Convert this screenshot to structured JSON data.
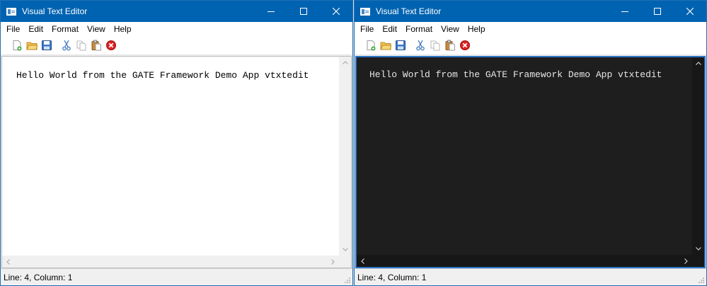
{
  "windows": [
    {
      "title": "Visual Text Editor",
      "theme": "light",
      "menu": [
        "File",
        "Edit",
        "Format",
        "View",
        "Help"
      ],
      "editor_text": "Hello World from the GATE Framework Demo App vtxtedit",
      "status": "Line: 4, Column: 1"
    },
    {
      "title": "Visual Text Editor",
      "theme": "dark",
      "menu": [
        "File",
        "Edit",
        "Format",
        "View",
        "Help"
      ],
      "editor_text": "Hello World from the GATE Framework Demo App vtxtedit",
      "status": "Line: 4, Column: 1"
    }
  ],
  "toolbar_icons": [
    "new-file-icon",
    "open-folder-icon",
    "save-icon",
    "cut-icon",
    "copy-icon",
    "paste-icon",
    "close-document-icon"
  ],
  "colors": {
    "titlebar": "#0063b1",
    "dark_editor_bg": "#1e1e1e",
    "focus_border": "#2b73c4"
  }
}
